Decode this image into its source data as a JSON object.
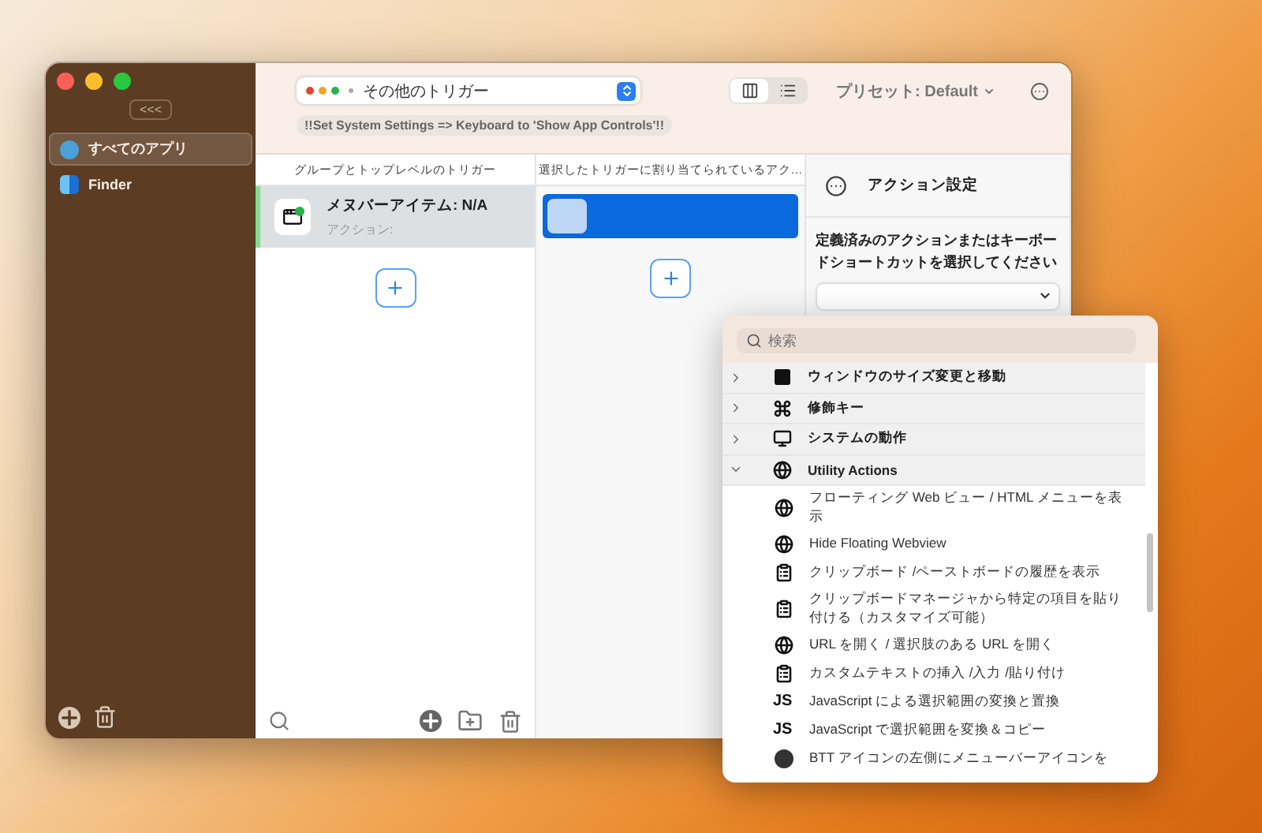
{
  "sidebar": {
    "collapse_label": "<<<",
    "items": [
      {
        "label": "すべてのアプリ",
        "kind": "all",
        "selected": true
      },
      {
        "label": "Finder",
        "kind": "finder",
        "selected": false
      }
    ]
  },
  "toolbar": {
    "trigger_select": "その他のトリガー",
    "banner": "!!Set System Settings => Keyboard to 'Show App Controls'!!",
    "view_modes": [
      {
        "kind": "columns",
        "selected": true
      },
      {
        "kind": "list",
        "selected": false
      }
    ],
    "preset": "プリセット: Default"
  },
  "triggers": {
    "header": "グループとトップレベルのトリガー",
    "items": [
      {
        "title": "メヌバーアイテム: N/A",
        "subtitle": "アクション:",
        "selected": true
      }
    ]
  },
  "actions": {
    "header": "選択したトリガーに割り当てられているアク…",
    "items": [
      {
        "selected": true
      }
    ]
  },
  "action_settings": {
    "title": "アクション設定",
    "prompt": "定義済みのアクションまたはキーボードショートカットを選択してください"
  },
  "picker": {
    "placeholder": "検索",
    "categories": [
      {
        "label": "ウィンドウのサイズ変更と移動",
        "kind": "window",
        "expanded": false
      },
      {
        "label": "修飾キー",
        "kind": "command",
        "expanded": false
      },
      {
        "label": "システムの動作",
        "kind": "monitor",
        "expanded": false
      },
      {
        "label": "Utility Actions",
        "kind": "web",
        "expanded": true,
        "children": [
          {
            "label": "フローティング Web ビュー / HTML メニューを表示",
            "kind": "web"
          },
          {
            "label": "Hide Floating Webview",
            "kind": "web"
          },
          {
            "label": "クリップボード /ペーストボードの履歴を表示",
            "kind": "clipboard"
          },
          {
            "label": "クリップボードマネージャから特定の項目を貼り付ける（カスタマイズ可能）",
            "kind": "clipboard"
          },
          {
            "label": "URL を開く / 選択肢のある URL を開く",
            "kind": "web"
          },
          {
            "label": "カスタムテキストの挿入 /入力 /貼り付け",
            "kind": "clipboard"
          },
          {
            "label": "JavaScript による選択範囲の変換と置換",
            "kind": "script",
            "icon_text": "JS"
          },
          {
            "label": "JavaScript で選択範囲を変換＆コピー",
            "kind": "script",
            "icon_text": "JS"
          },
          {
            "label": "BTT アイコンの左側にメニューバーアイコンを",
            "kind": "menubar"
          }
        ]
      }
    ]
  }
}
